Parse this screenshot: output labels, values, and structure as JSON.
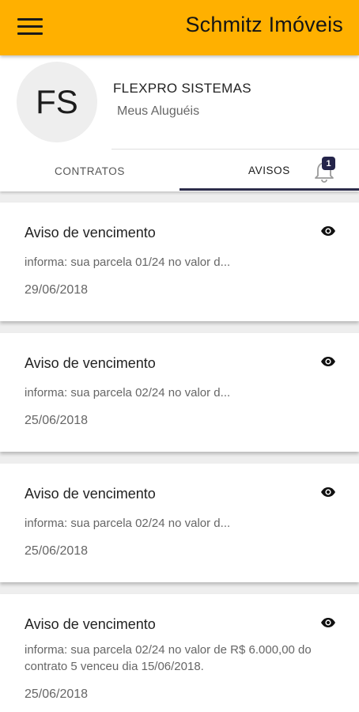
{
  "appbar": {
    "title": "Schmitz Imóveis"
  },
  "profile": {
    "initials": "FS",
    "name": "FLEXPRO SISTEMAS",
    "subtitle": "Meus Aluguéis"
  },
  "tabs": {
    "contratos": "CONTRATOS",
    "avisos": "AVISOS",
    "badge": "1"
  },
  "notices": [
    {
      "title": "Aviso de vencimento",
      "text": "informa: sua parcela 01/24 no valor d...",
      "date": "29/06/2018"
    },
    {
      "title": "Aviso de vencimento",
      "text": "informa: sua parcela 02/24 no valor d...",
      "date": "25/06/2018"
    },
    {
      "title": "Aviso de vencimento",
      "text": "informa: sua parcela 02/24 no valor d...",
      "date": "25/06/2018"
    },
    {
      "title": "Aviso de vencimento",
      "text": "informa: sua parcela 02/24 no valor de R$ 6.000,00 do contrato 5 venceu dia 15/06/2018.",
      "date": "25/06/2018"
    }
  ],
  "colors": {
    "appbar": "#FFB000",
    "tab_indicator": "#2C2C4A",
    "badge": "#24244A"
  },
  "icons": {
    "menu": "menu-icon",
    "bell": "bell-icon",
    "eye": "eye-icon"
  }
}
